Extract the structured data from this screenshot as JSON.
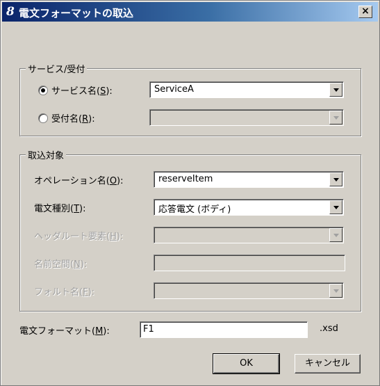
{
  "window": {
    "title": "電文フォーマットの取込",
    "app_icon": "8",
    "close_label": "×"
  },
  "service_group": {
    "title": "サービス/受付",
    "service_radio": {
      "label": "サービス名(",
      "mnemonic": "S",
      "suffix": "):",
      "selected": true
    },
    "service_combo": {
      "value": "ServiceA"
    },
    "reception_radio": {
      "label": "受付名(",
      "mnemonic": "R",
      "suffix": "):",
      "selected": false
    },
    "reception_combo": {
      "value": ""
    }
  },
  "target_group": {
    "title": "取込対象",
    "operation": {
      "label": "オペレーション名(",
      "mnemonic": "O",
      "suffix": "):",
      "value": "reserveItem"
    },
    "message_type": {
      "label": "電文種別(",
      "mnemonic": "T",
      "suffix": "):",
      "value": "応答電文 (ボディ)"
    },
    "header_root": {
      "label": "ヘッダルート要素(",
      "mnemonic": "H",
      "suffix": "):",
      "value": ""
    },
    "namespace": {
      "label": "名前空間(",
      "mnemonic": "N",
      "suffix": "):",
      "value": ""
    },
    "fault_name": {
      "label": "フォルト名(",
      "mnemonic": "F",
      "suffix": "):",
      "value": ""
    }
  },
  "message_format": {
    "label": "電文フォーマット(",
    "mnemonic": "M",
    "suffix": "):",
    "value": "F1",
    "extension": ".xsd"
  },
  "buttons": {
    "ok": "OK",
    "cancel": "キャンセル"
  }
}
